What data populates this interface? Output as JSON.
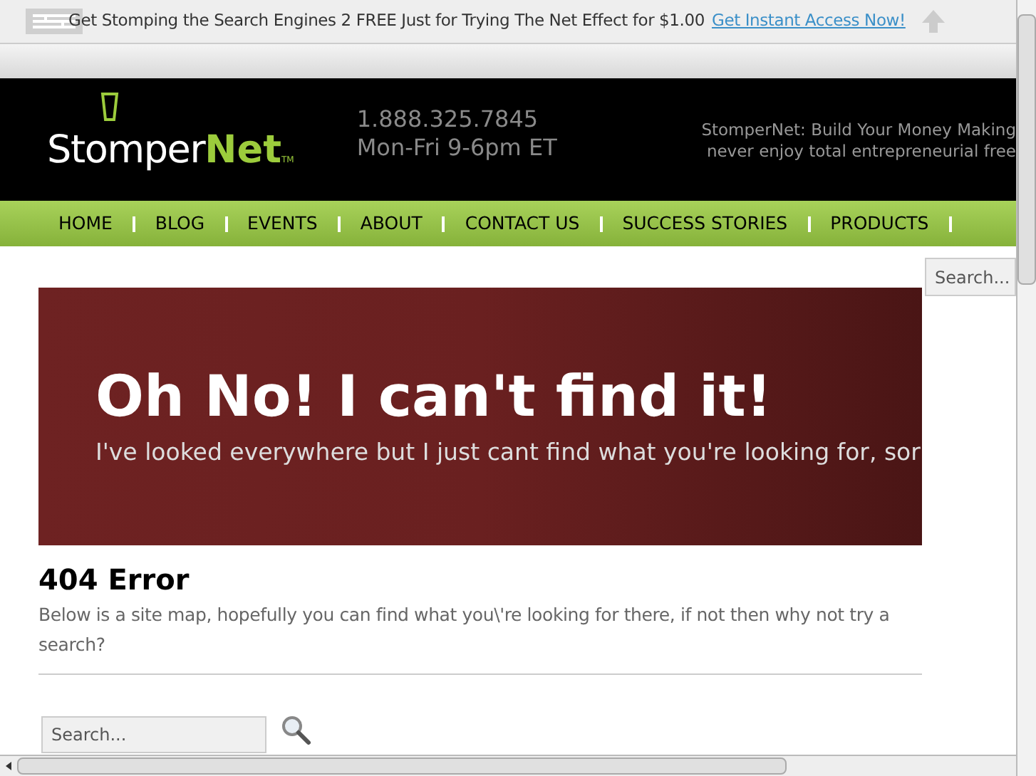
{
  "promo_bar": {
    "text": "Get Stomping the Search Engines 2 FREE Just for Trying The Net Effect for $1.00",
    "link": "Get Instant Access Now!"
  },
  "header": {
    "logo_main": "Stomper",
    "logo_accent": "Net",
    "logo_tm": "TM",
    "phone": "1.888.325.7845",
    "hours": "Mon-Fri 9-6pm ET",
    "tagline_1": "StomperNet: Build Your Money Making",
    "tagline_2": "never enjoy total entrepreneurial free"
  },
  "nav": {
    "items": [
      "HOME",
      "BLOG",
      "EVENTS",
      "ABOUT",
      "CONTACT US",
      "SUCCESS STORIES",
      "PRODUCTS"
    ]
  },
  "side_search": {
    "placeholder": "Search..."
  },
  "banner": {
    "title": "Oh No! I can't find it!",
    "subtitle": "I've looked everywhere but I just cant find what you're looking for, sor"
  },
  "error": {
    "heading": "404 Error",
    "text": "Below is a site map, hopefully you can find what you\\'re looking for there, if not then why not try a search?"
  },
  "search": {
    "placeholder": "Search..."
  }
}
